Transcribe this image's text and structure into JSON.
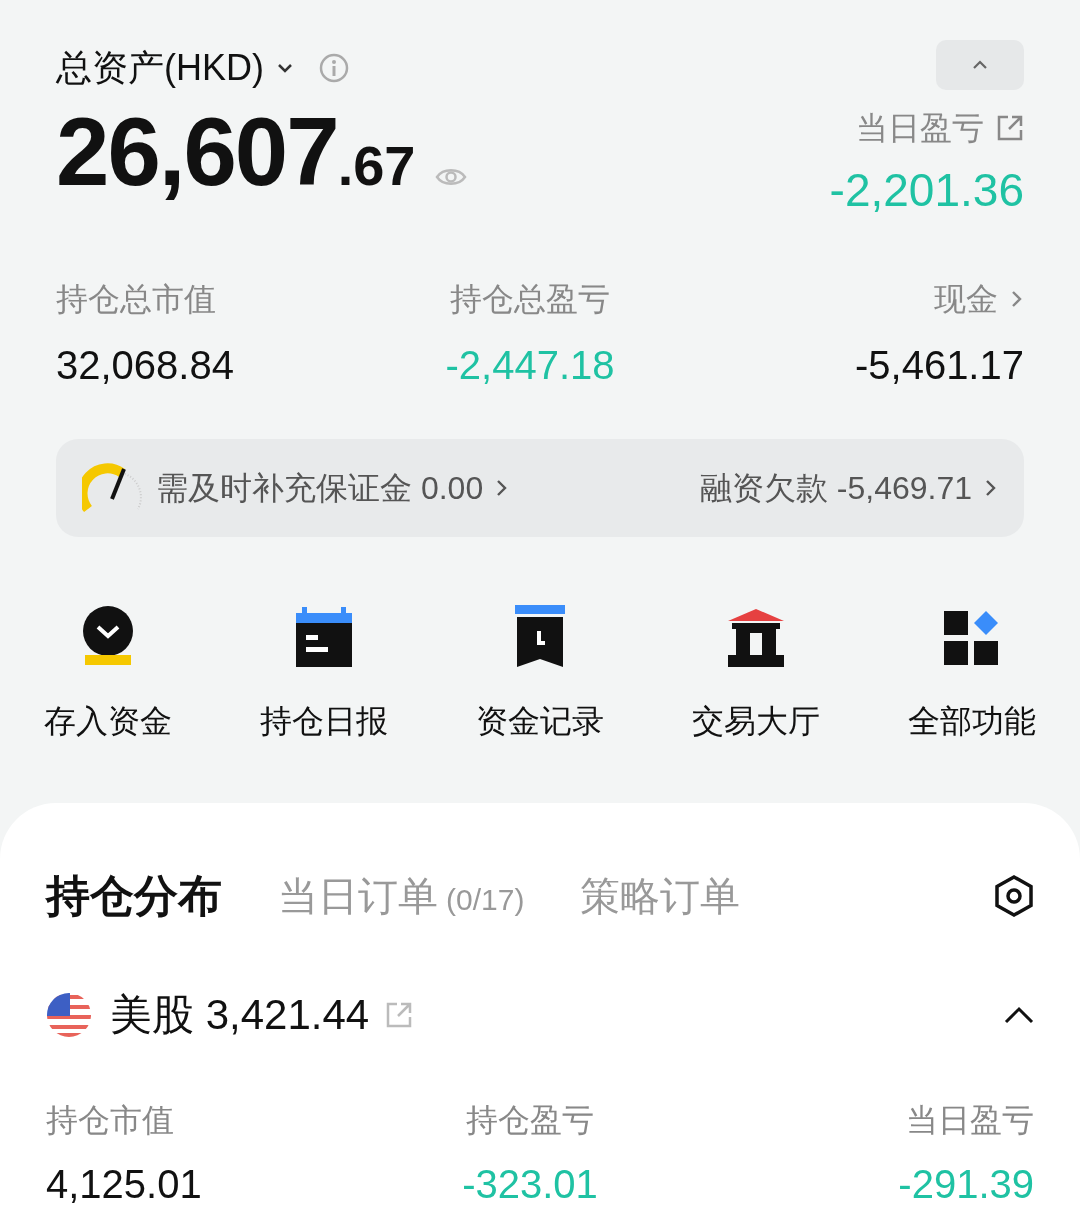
{
  "summary": {
    "title": "总资产(HKD)",
    "total_integer": "26,607",
    "total_decimal": ".67",
    "day_pnl_label": "当日盈亏",
    "day_pnl": "-2,201.36"
  },
  "stats": [
    {
      "label": "持仓总市值",
      "value": "32,068.84",
      "color": "#111111",
      "link": false
    },
    {
      "label": "持仓总盈亏",
      "value": "-2,447.18",
      "color": "#1fc2a3",
      "link": false
    },
    {
      "label": "现金",
      "value": "-5,461.17",
      "color": "#111111",
      "link": true
    }
  ],
  "margin_bar": {
    "left_label": "需及时补充保证金",
    "left_value": "0.00",
    "right_label": "融资欠款",
    "right_value": "-5,469.71"
  },
  "shortcuts": [
    {
      "label": "存入资金",
      "kind": "deposit"
    },
    {
      "label": "持仓日报",
      "kind": "calendar"
    },
    {
      "label": "资金记录",
      "kind": "record"
    },
    {
      "label": "交易大厅",
      "kind": "hall"
    },
    {
      "label": "全部功能",
      "kind": "all"
    }
  ],
  "tabs": [
    {
      "label": "持仓分布",
      "selected": true
    },
    {
      "label": "当日订单",
      "count": "(0/17)",
      "selected": false
    },
    {
      "label": "策略订单",
      "selected": false
    }
  ],
  "market": {
    "name": "美股",
    "value": "3,421.44",
    "expanded": true,
    "stats": [
      {
        "label": "持仓市值",
        "value": "4,125.01",
        "color": "#111111"
      },
      {
        "label": "持仓盈亏",
        "value": "-323.01",
        "color": "#1fc2a3"
      },
      {
        "label": "当日盈亏",
        "value": "-291.39",
        "color": "#1fc2a3"
      }
    ]
  }
}
